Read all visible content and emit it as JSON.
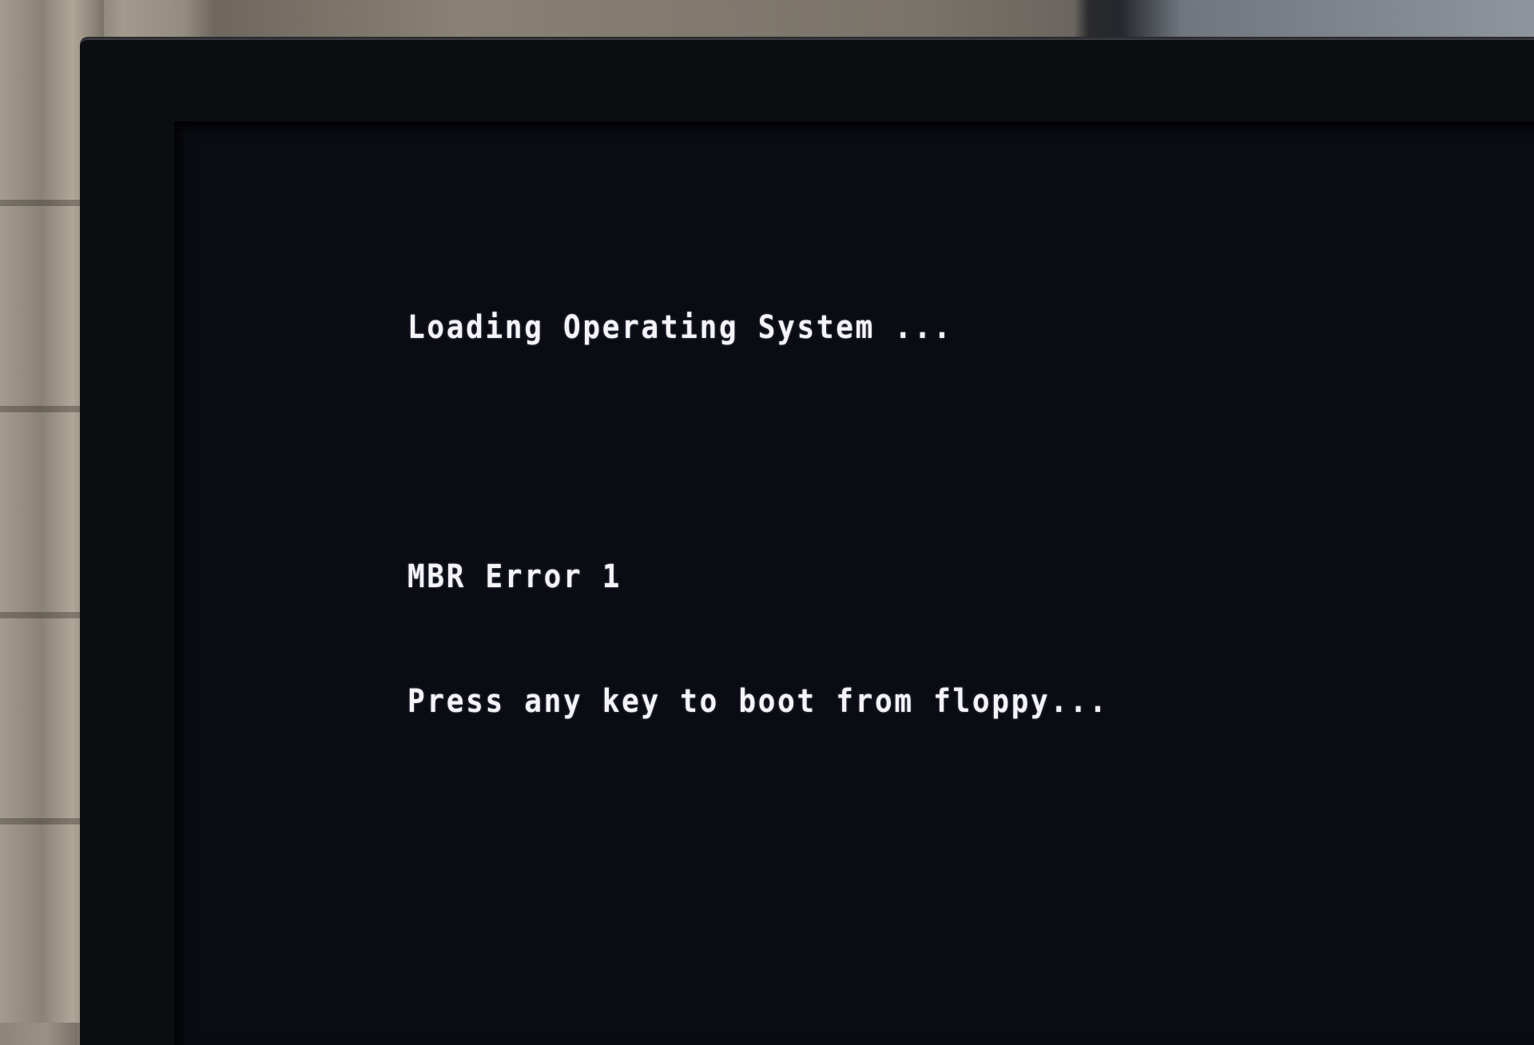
{
  "screen": {
    "background_color": "#0b0c13",
    "text_color": "#f4f4f8",
    "lines": [
      "Loading Operating System ...",
      "",
      "MBR Error 1",
      "Press any key to boot from floppy..."
    ]
  }
}
